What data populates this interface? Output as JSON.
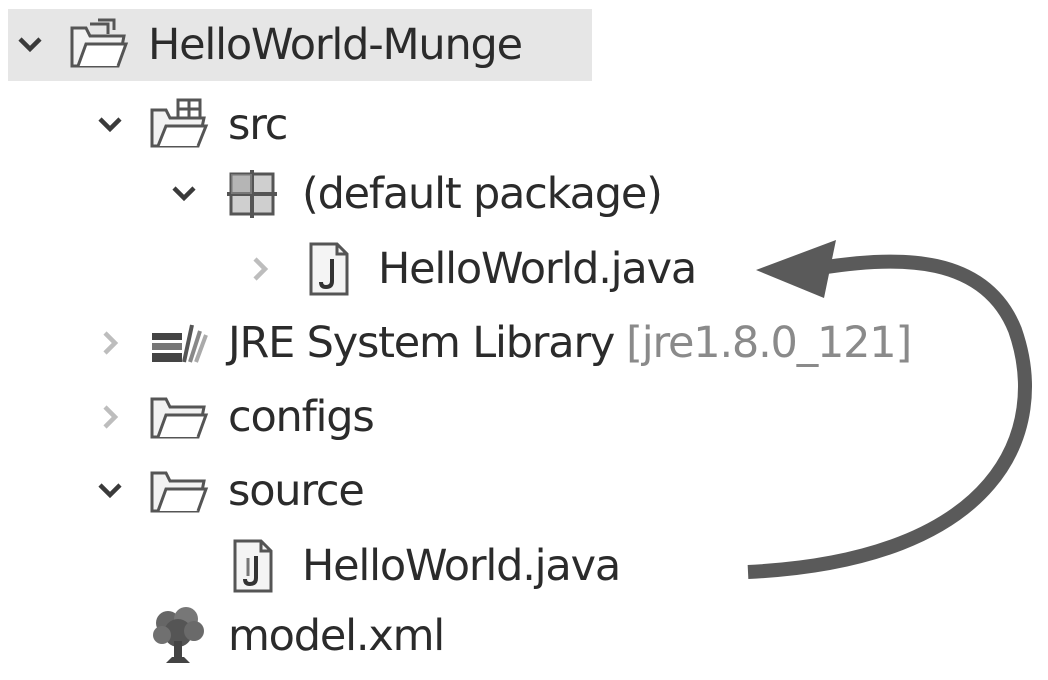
{
  "tree": {
    "project": {
      "label": "HelloWorld-Munge",
      "expanded": true,
      "icon": "project-folder-icon"
    },
    "src": {
      "label": "src",
      "expanded": true,
      "icon": "source-folder-icon"
    },
    "default_package": {
      "label": "(default package)",
      "expanded": true,
      "icon": "package-icon"
    },
    "src_helloworld_java": {
      "label": "HelloWorld.java",
      "expanded": false,
      "icon": "java-file-icon"
    },
    "jre_library": {
      "label": "JRE System Library",
      "decoration": "[jre1.8.0_121]",
      "expanded": false,
      "icon": "library-icon"
    },
    "configs": {
      "label": "configs",
      "expanded": false,
      "icon": "folder-icon"
    },
    "source": {
      "label": "source",
      "expanded": true,
      "icon": "folder-icon"
    },
    "source_helloworld_java": {
      "label": "HelloWorld.java",
      "icon": "java-file-icon"
    },
    "model_xml": {
      "label": "model.xml",
      "icon": "tree-icon"
    }
  },
  "annotation": {
    "arrow_color": "#5a5a5a",
    "selection_color": "#e6e6e6"
  }
}
